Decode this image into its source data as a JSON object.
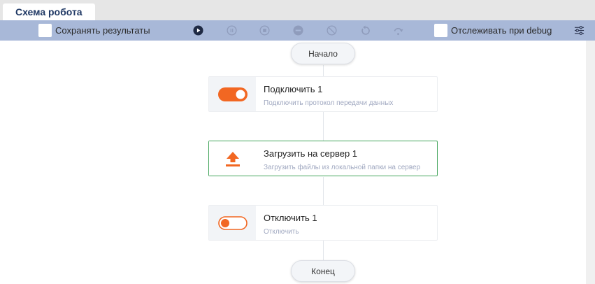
{
  "tab": {
    "label": "Схема робота"
  },
  "toolbar": {
    "save_results_label": "Сохранять результаты",
    "debug_track_label": "Отслеживать при debug",
    "icons": [
      "play-icon",
      "pause-icon",
      "stop-icon",
      "disable-icon",
      "block-icon",
      "restart-icon",
      "step-over-icon",
      "settings-sliders-icon"
    ]
  },
  "flow": {
    "start_label": "Начало",
    "end_label": "Конец",
    "nodes": [
      {
        "title": "Подключить 1",
        "subtitle": "Подключить протокол передачи данных",
        "icon": "toggle-on-icon"
      },
      {
        "title": "Загрузить на сервер 1",
        "subtitle": "Загрузить файлы из локальной папки на сервер",
        "icon": "upload-icon"
      },
      {
        "title": "Отключить 1",
        "subtitle": "Отключить",
        "icon": "toggle-off-icon"
      }
    ]
  },
  "colors": {
    "accent": "#f26722",
    "toolbar": "#a8b8d8",
    "tab_text": "#1f3864",
    "active_border": "#43a55b"
  }
}
